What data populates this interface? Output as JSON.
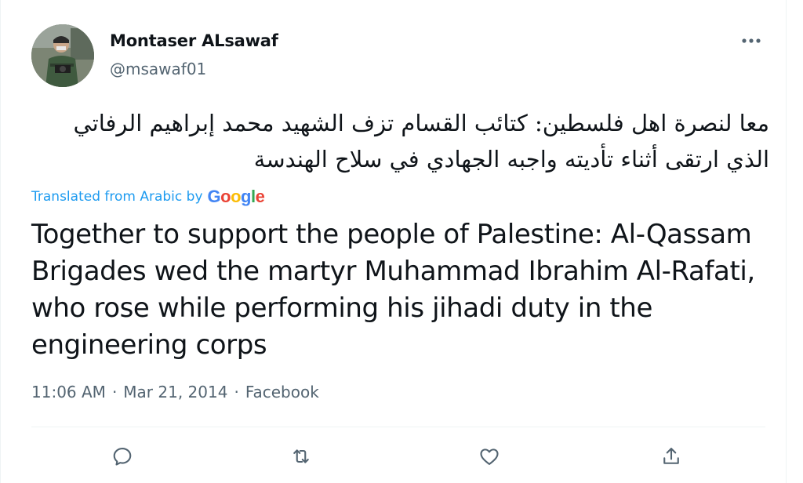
{
  "author": {
    "display_name": "Montaser ALsawaf",
    "handle": "@msawaf01",
    "avatar_icon": "profile-photo"
  },
  "tweet": {
    "original_text": "معا لنصرة اهل فلسطين: كتائب القسام تزف الشهيد محمد إبراهيم الرفاتي الذي ارتقى أثناء تأديته واجبه الجهادي في سلاح الهندسة",
    "translated_from_label": "Translated from Arabic by",
    "translation_provider": "Google",
    "translation_text": "Together to support the people of Palestine: Al-Qassam Brigades wed the martyr Muhammad Ibrahim Al-Rafati, who rose while performing his jihadi duty in the engineering corps",
    "time": "11:06 AM",
    "separator": "·",
    "date": "Mar 21, 2014",
    "source": "Facebook"
  },
  "actions": {
    "reply_icon": "reply-icon",
    "retweet_icon": "retweet-icon",
    "like_icon": "like-icon",
    "share_icon": "share-icon"
  },
  "colors": {
    "text_primary": "#0f1419",
    "text_secondary": "#536471",
    "link_blue": "#1d9bf0",
    "divider": "#eff3f4"
  }
}
